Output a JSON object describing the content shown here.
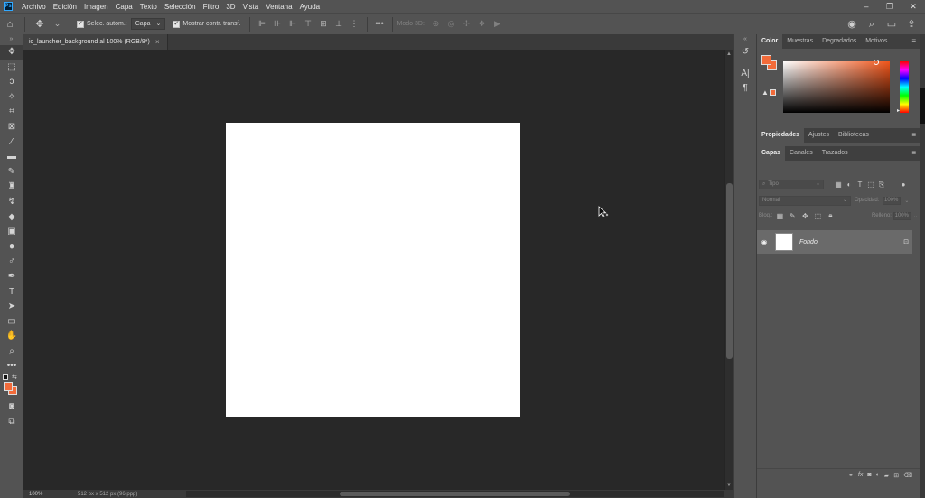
{
  "menu": {
    "app_logo": "Ps",
    "items": [
      "Archivo",
      "Edición",
      "Imagen",
      "Capa",
      "Texto",
      "Selección",
      "Filtro",
      "3D",
      "Vista",
      "Ventana",
      "Ayuda"
    ],
    "window_controls": [
      "–",
      "❐",
      "✕"
    ]
  },
  "options": {
    "auto_select_label": "Selec. autom.:",
    "auto_select_checked": true,
    "auto_select_target": "Capa",
    "show_transform_label": "Mostrar contr. transf.",
    "show_transform_checked": true,
    "mode_3d_label": "Modo 3D:",
    "more": "•••"
  },
  "document": {
    "tab_title": "ic_launcher_background al 100% (RGB/8*)",
    "close": "×",
    "zoom": "100%",
    "info": "512 px x 512 px (96 ppp)"
  },
  "colors": {
    "foreground": "#f26b3a",
    "background": "#f26b3a",
    "canvas": "#ffffff"
  },
  "panels": {
    "color_tabs": [
      "Color",
      "Muestras",
      "Degradados",
      "Motivos"
    ],
    "properties_tabs": [
      "Propiedades",
      "Ajustes",
      "Bibliotecas"
    ],
    "layers_tabs": [
      "Capas",
      "Canales",
      "Trazados"
    ],
    "layers": {
      "filter_placeholder": "Tipo",
      "blend_mode": "Normal",
      "opacity_label": "Opacidad:",
      "opacity_value": "100%",
      "lock_label": "Bloq.:",
      "fill_label": "Relleno:",
      "fill_value": "100%",
      "items": [
        {
          "name": "Fondo",
          "visible": true,
          "locked": true
        }
      ]
    }
  }
}
